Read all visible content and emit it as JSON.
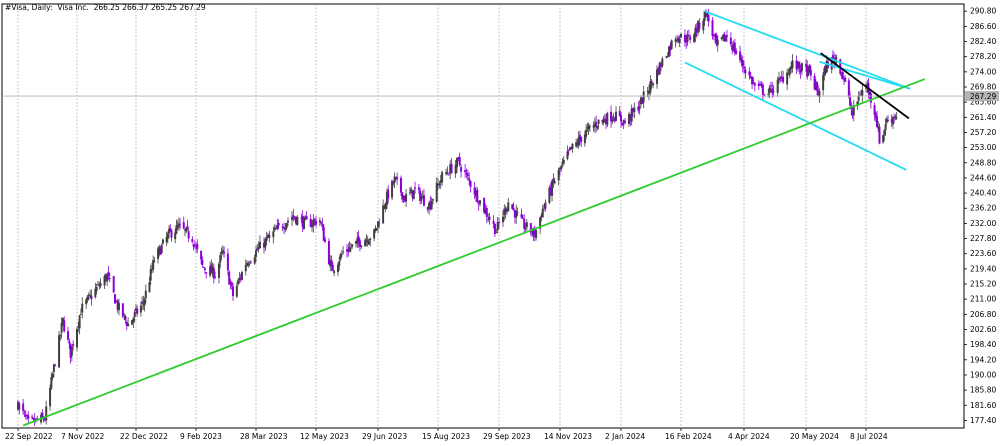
{
  "header": {
    "symbol": "#Visa, Daily:",
    "company": "Visa Inc.",
    "ohlc": "266.25 266.37 265.25 267.29"
  },
  "price_marker": "267.29",
  "colors": {
    "background": "#ffffff",
    "up_candle": "#404040",
    "down_candle": "#8b00d6",
    "grid": "#9a9a9a",
    "channel": "#24dcf0",
    "trendline_long": "#2ecc2e",
    "trendline_short": "#000000",
    "price_line": "#b0b0b0",
    "price_label_bg": "#b4b4b4"
  },
  "chart_data": {
    "type": "candlestick",
    "x_start": "2022-09-22",
    "x_end": "2024-08-02",
    "ylim": [
      175.3,
      292.8
    ],
    "x_tick_labels": [
      "22 Sep 2022",
      "7 Nov 2022",
      "22 Dec 2022",
      "9 Feb 2023",
      "28 Mar 2023",
      "12 May 2023",
      "29 Jun 2023",
      "15 Aug 2023",
      "29 Sep 2023",
      "14 Nov 2023",
      "2 Jan 2024",
      "16 Feb 2024",
      "4 Apr 2024",
      "20 May 2024",
      "8 Jul 2024"
    ],
    "y_tick_labels": [
      290.8,
      286.6,
      282.4,
      278.2,
      274.0,
      269.8,
      265.6,
      261.4,
      257.2,
      253.0,
      248.8,
      244.6,
      240.4,
      236.2,
      232.0,
      227.8,
      223.6,
      219.4,
      215.2,
      211.0,
      206.8,
      202.6,
      198.4,
      194.2,
      190.0,
      185.8,
      181.6,
      177.4
    ],
    "grid": "vertical dotted",
    "current_price": 267.29,
    "price_path": [
      [
        "2022-09-22",
        182.0
      ],
      [
        "2022-09-30",
        176.5
      ],
      [
        "2022-10-13",
        178.0
      ],
      [
        "2022-10-20",
        192.0
      ],
      [
        "2022-10-27",
        205.0
      ],
      [
        "2022-11-02",
        196.0
      ],
      [
        "2022-11-10",
        208.0
      ],
      [
        "2022-11-20",
        213.0
      ],
      [
        "2022-11-30",
        217.5
      ],
      [
        "2022-12-08",
        209.0
      ],
      [
        "2022-12-16",
        204.0
      ],
      [
        "2022-12-28",
        210.0
      ],
      [
        "2023-01-06",
        222.0
      ],
      [
        "2023-01-18",
        229.0
      ],
      [
        "2023-01-26",
        231.0
      ],
      [
        "2023-02-06",
        228.0
      ],
      [
        "2023-02-14",
        220.0
      ],
      [
        "2023-02-24",
        218.0
      ],
      [
        "2023-03-02",
        224.0
      ],
      [
        "2023-03-10",
        212.0
      ],
      [
        "2023-03-20",
        221.0
      ],
      [
        "2023-03-30",
        225.0
      ],
      [
        "2023-04-12",
        230.0
      ],
      [
        "2023-04-24",
        234.0
      ],
      [
        "2023-05-05",
        232.0
      ],
      [
        "2023-05-15",
        233.0
      ],
      [
        "2023-05-24",
        219.0
      ],
      [
        "2023-06-02",
        224.0
      ],
      [
        "2023-06-15",
        227.0
      ],
      [
        "2023-06-26",
        229.0
      ],
      [
        "2023-07-05",
        238.5
      ],
      [
        "2023-07-12",
        244.0
      ],
      [
        "2023-07-20",
        239.0
      ],
      [
        "2023-07-28",
        241.0
      ],
      [
        "2023-08-08",
        237.0
      ],
      [
        "2023-08-18",
        245.0
      ],
      [
        "2023-08-30",
        249.0
      ],
      [
        "2023-09-08",
        243.0
      ],
      [
        "2023-09-18",
        236.0
      ],
      [
        "2023-09-27",
        230.0
      ],
      [
        "2023-10-06",
        238.0
      ],
      [
        "2023-10-16",
        232.0
      ],
      [
        "2023-10-26",
        229.0
      ],
      [
        "2023-11-01",
        236.0
      ],
      [
        "2023-11-10",
        244.0
      ],
      [
        "2023-11-22",
        252.0
      ],
      [
        "2023-12-04",
        257.0
      ],
      [
        "2023-12-14",
        260.0
      ],
      [
        "2023-12-27",
        262.0
      ],
      [
        "2024-01-05",
        260.0
      ],
      [
        "2024-01-16",
        265.0
      ],
      [
        "2024-01-25",
        271.0
      ],
      [
        "2024-02-02",
        277.0
      ],
      [
        "2024-02-12",
        284.0
      ],
      [
        "2024-02-22",
        283.0
      ],
      [
        "2024-03-01",
        287.0
      ],
      [
        "2024-03-06",
        290.5
      ],
      [
        "2024-03-14",
        281.0
      ],
      [
        "2024-03-22",
        284.0
      ],
      [
        "2024-04-03",
        276.0
      ],
      [
        "2024-04-12",
        270.0
      ],
      [
        "2024-04-22",
        268.0
      ],
      [
        "2024-05-02",
        272.0
      ],
      [
        "2024-05-10",
        276.0
      ],
      [
        "2024-05-22",
        274.0
      ],
      [
        "2024-05-30",
        268.0
      ],
      [
        "2024-06-06",
        276.0
      ],
      [
        "2024-06-14",
        278.0
      ],
      [
        "2024-06-20",
        272.0
      ],
      [
        "2024-06-27",
        262.0
      ],
      [
        "2024-07-03",
        268.0
      ],
      [
        "2024-07-09",
        270.0
      ],
      [
        "2024-07-16",
        262.0
      ],
      [
        "2024-07-20",
        253.0
      ],
      [
        "2024-07-24",
        260.0
      ],
      [
        "2024-08-01",
        262.0
      ]
    ],
    "trendlines": [
      {
        "name": "channel-upper",
        "color": "#24dcf0",
        "points": [
          [
            "2024-03-05",
            290.8
          ],
          [
            "2024-08-13",
            269.3
          ]
        ]
      },
      {
        "name": "channel-lower",
        "color": "#24dcf0",
        "points": [
          [
            "2024-02-19",
            276.6
          ],
          [
            "2024-08-10",
            246.8
          ]
        ]
      },
      {
        "name": "channel-mid",
        "color": "#24dcf0",
        "points": [
          [
            "2024-05-31",
            276.8
          ],
          [
            "2024-08-13",
            269.3
          ]
        ]
      },
      {
        "name": "long-uptrend",
        "color": "#2ecc2e",
        "points": [
          [
            "2022-09-26",
            176.0
          ],
          [
            "2024-08-25",
            272.0
          ]
        ]
      },
      {
        "name": "short-downtrend",
        "color": "#000000",
        "points": [
          [
            "2024-06-01",
            279.2
          ],
          [
            "2024-08-12",
            261.1
          ]
        ]
      }
    ]
  }
}
